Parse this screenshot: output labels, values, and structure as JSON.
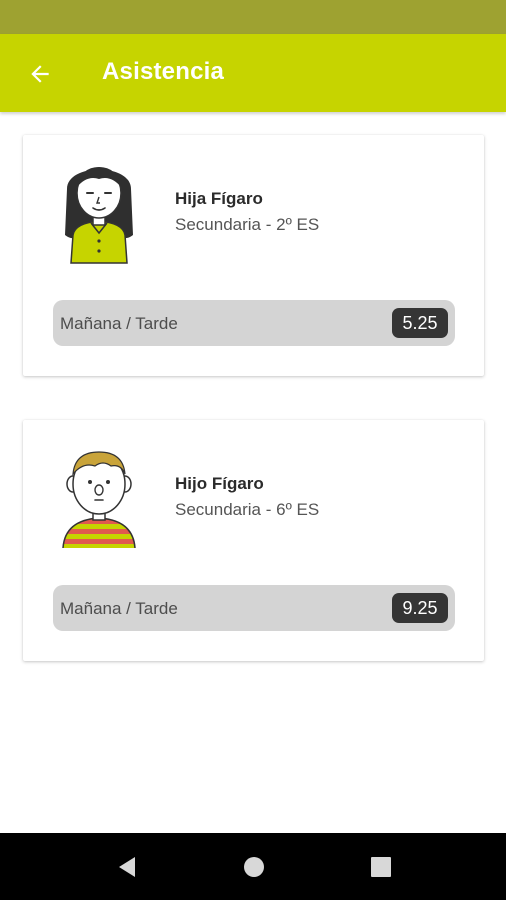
{
  "app": {
    "title": "Asistencia",
    "accent_color": "#c6d400",
    "status_bar_color": "#9ea231"
  },
  "students": [
    {
      "name": "Hija Fígaro",
      "course": "Secundaria - 2º ES",
      "attendance_label": "Mañana / Tarde",
      "attendance_value": "5.25",
      "avatar_icon": "girl-avatar-icon"
    },
    {
      "name": "Hijo Fígaro",
      "course": "Secundaria - 6º ES",
      "attendance_label": "Mañana / Tarde",
      "attendance_value": "9.25",
      "avatar_icon": "boy-avatar-icon"
    }
  ],
  "navigation": {
    "back_icon": "back-arrow-icon",
    "system_buttons": [
      "back-triangle-icon",
      "home-circle-icon",
      "recents-square-icon"
    ]
  }
}
